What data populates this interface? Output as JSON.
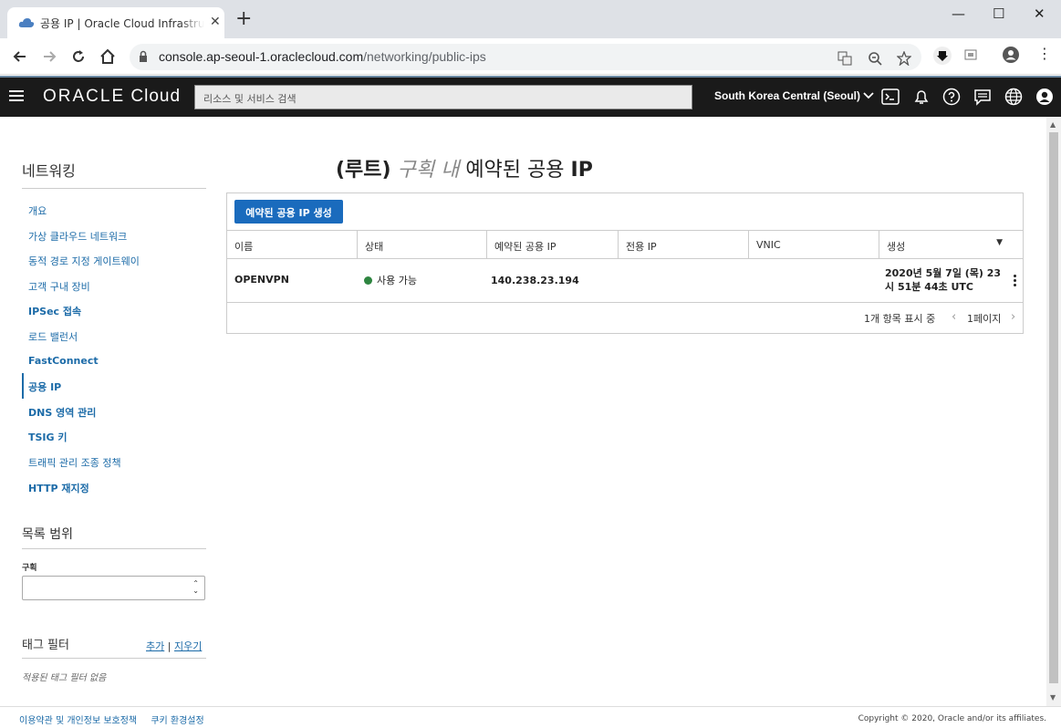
{
  "browser": {
    "tab_title": "공용 IP | Oracle Cloud Infrastructure",
    "new_tab": "+",
    "url_host": "console.ap-seoul-1.oraclecloud.com",
    "url_path": "/networking/public-ips"
  },
  "header": {
    "logo_oracle": "ORACLE",
    "logo_cloud": " Cloud",
    "search_placeholder": "리소스 및 서비스 검색",
    "region": "South Korea Central (Seoul)"
  },
  "sidebar": {
    "title": "네트워킹",
    "items": [
      {
        "label": "개요"
      },
      {
        "label": "가상 클라우드 네트워크"
      },
      {
        "label": "동적 경로 지정 게이트웨이"
      },
      {
        "label": "고객 구내 장비"
      },
      {
        "label": "IPSec 접속"
      },
      {
        "label": "로드 밸런서"
      },
      {
        "label": "FastConnect"
      },
      {
        "label": "공용 IP"
      },
      {
        "label": "DNS 영역 관리"
      },
      {
        "label": "TSIG 키"
      },
      {
        "label": "트래픽 관리 조종 정책"
      },
      {
        "label": "HTTP 재지정"
      }
    ],
    "scope_title": "목록 범위",
    "compartment_label": "구획",
    "compartment_value": "",
    "tag_filter_title": "태그 필터",
    "tag_add": "추가",
    "tag_sep": " | ",
    "tag_clear": "지우기",
    "tag_empty": "적용된 태그 필터 없음"
  },
  "main": {
    "title_paren": "(루트)",
    "title_in": "구획 내",
    "title_rest": "예약된 공용",
    "title_ip": "IP",
    "create_button": "예약된 공용 IP 생성",
    "columns": [
      "이름",
      "상태",
      "예약된 공용 IP",
      "전용 IP",
      "VNIC",
      "생성"
    ],
    "sort_indicator": "▼",
    "rows": [
      {
        "name": "OPENVPN",
        "status": "사용 가능",
        "public_ip": "140.238.23.194",
        "private_ip": "",
        "vnic": "",
        "created_line1": "2020년 5월 7일 (목) 23",
        "created_line2": "시 51분 44초 UTC"
      }
    ],
    "status_color": "#2e8540",
    "count_text": "1개 항목 표시 중",
    "page_text": "1페이지"
  },
  "footer": {
    "terms": "이용약관 및 개인정보 보호정책",
    "cookies": "쿠키 환경설정",
    "copyright": "Copyright © 2020, Oracle and/or its affiliates."
  },
  "colors": {
    "accent": "#1a6bbd",
    "header_bg": "#1a1a1a",
    "link": "#1c6ba8"
  }
}
